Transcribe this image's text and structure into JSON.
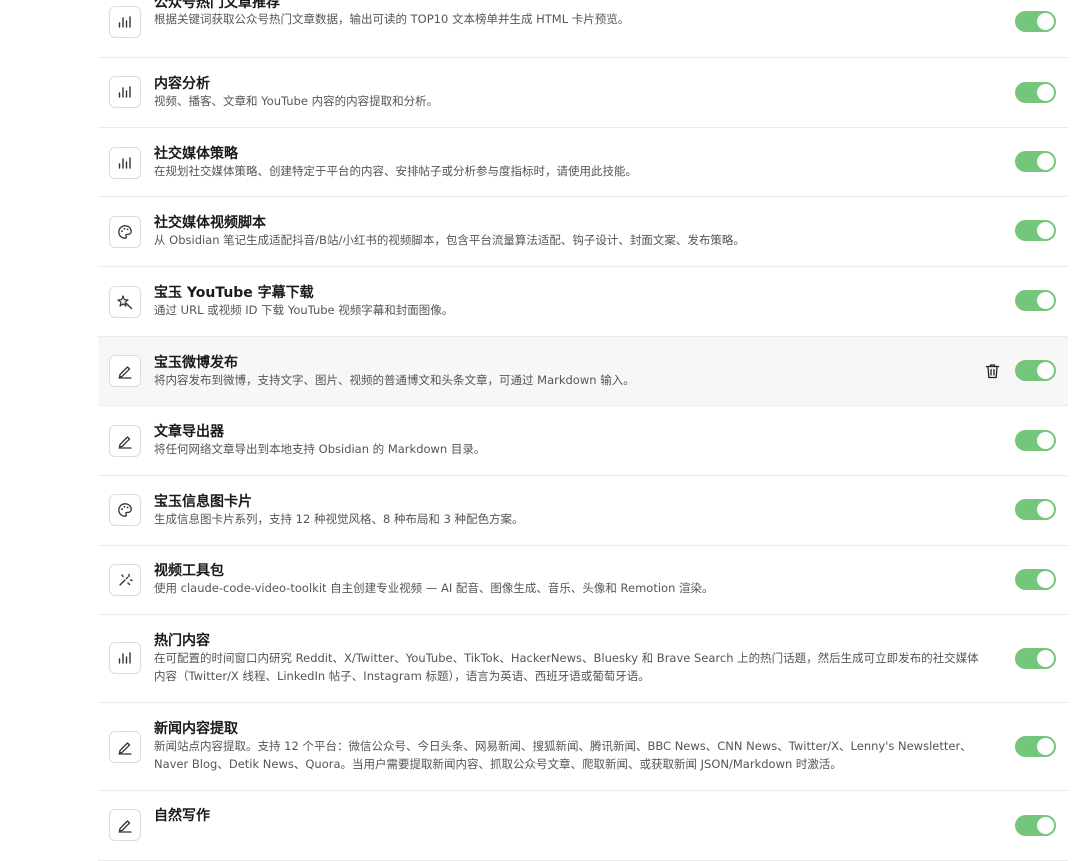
{
  "skills": [
    {
      "title": "公众号热门文章推荐",
      "desc": "根据关键词获取公众号热门文章数据，输出可读的 TOP10 文本榜单并生成 HTML 卡片预览。",
      "icon": "bar-chart-icon",
      "enabled": true
    },
    {
      "title": "内容分析",
      "desc": "视频、播客、文章和 YouTube 内容的内容提取和分析。",
      "icon": "bar-chart-icon",
      "enabled": true
    },
    {
      "title": "社交媒体策略",
      "desc": "在规划社交媒体策略、创建特定于平台的内容、安排帖子或分析参与度指标时，请使用此技能。",
      "icon": "bar-chart-icon",
      "enabled": true
    },
    {
      "title": "社交媒体视频脚本",
      "desc": "从 Obsidian 笔记生成适配抖音/B站/小红书的视频脚本，包含平台流量算法适配、钩子设计、封面文案、发布策略。",
      "icon": "palette-icon",
      "enabled": true
    },
    {
      "title": "宝玉 YouTube 字幕下载",
      "desc": "通过 URL 或视频 ID 下载 YouTube 视频字幕和封面图像。",
      "icon": "magic-wand-icon",
      "enabled": true
    },
    {
      "title": "宝玉微博发布",
      "desc": "将内容发布到微博，支持文字、图片、视频的普通博文和头条文章，可通过 Markdown 输入。",
      "icon": "pencil-icon",
      "enabled": true,
      "hover": true
    },
    {
      "title": "文章导出器",
      "desc": "将任何网络文章导出到本地支持 Obsidian 的 Markdown 目录。",
      "icon": "pencil-icon",
      "enabled": true
    },
    {
      "title": "宝玉信息图卡片",
      "desc": "生成信息图卡片系列，支持 12 种视觉风格、8 种布局和 3 种配色方案。",
      "icon": "palette-icon",
      "enabled": true
    },
    {
      "title": "视频工具包",
      "desc": "使用 claude-code-video-toolkit 自主创建专业视频 — AI 配音、图像生成、音乐、头像和 Remotion 渲染。",
      "icon": "sparkle-icon",
      "enabled": true
    },
    {
      "title": "热门内容",
      "desc": "在可配置的时间窗口内研究 Reddit、X/Twitter、YouTube、TikTok、HackerNews、Bluesky 和 Brave Search 上的热门话题，然后生成可立即发布的社交媒体内容（Twitter/X 线程、LinkedIn 帖子、Instagram 标题），语言为英语、西班牙语或葡萄牙语。",
      "icon": "bar-chart-icon",
      "enabled": true
    },
    {
      "title": "新闻内容提取",
      "desc": "新闻站点内容提取。支持 12 个平台：微信公众号、今日头条、网易新闻、搜狐新闻、腾讯新闻、BBC News、CNN News、Twitter/X、Lenny's Newsletter、Naver Blog、Detik News、Quora。当用户需要提取新闻内容、抓取公众号文章、爬取新闻、或获取新闻 JSON/Markdown 时激活。",
      "icon": "pencil-icon",
      "enabled": true
    },
    {
      "title": "自然写作",
      "desc": "",
      "icon": "pencil-icon",
      "enabled": true
    }
  ],
  "colors": {
    "toggle_on": "#73c67a",
    "divider": "#ebebeb",
    "hover_bg": "#f7f7f7"
  }
}
